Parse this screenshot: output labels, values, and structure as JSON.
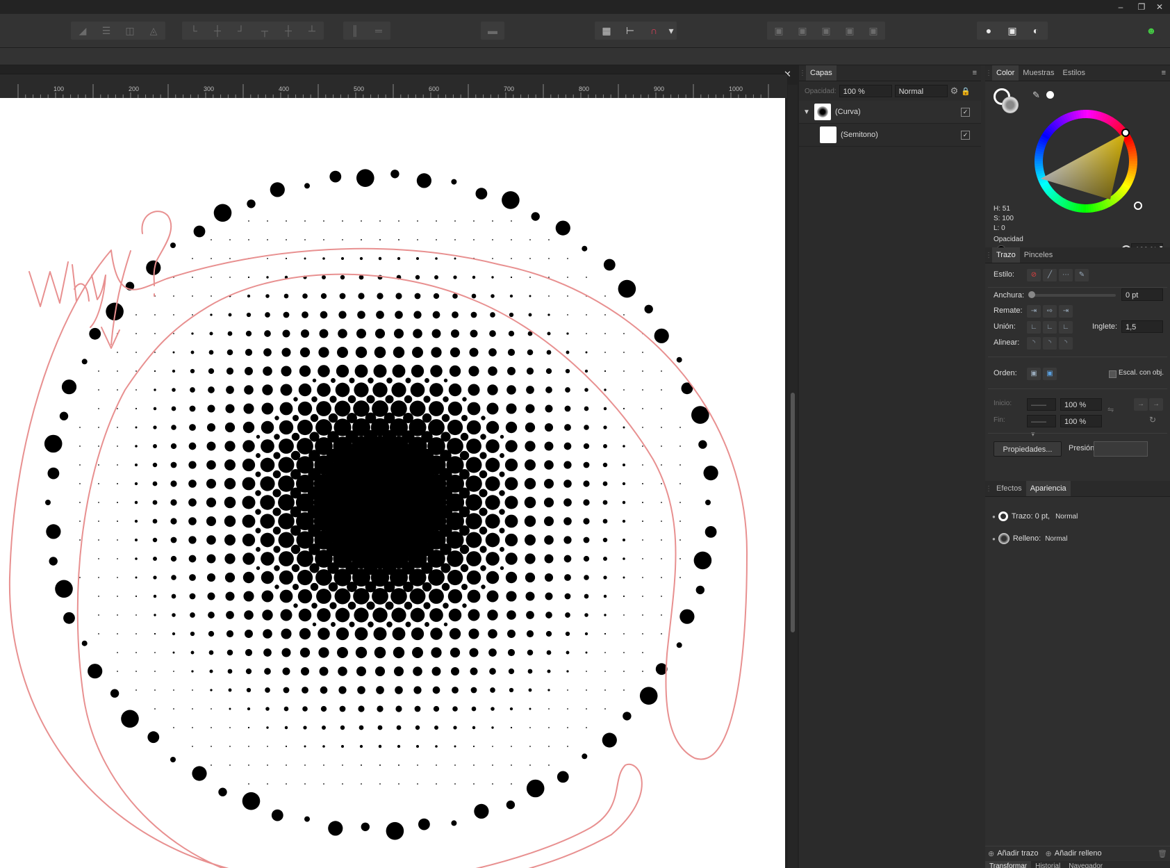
{
  "ruler": {
    "ticks": [
      "100",
      "200",
      "300",
      "400",
      "500",
      "600",
      "700",
      "800",
      "900",
      "1000"
    ]
  },
  "annotation": {
    "text": "Why?"
  },
  "layers_panel": {
    "tab": "Capas",
    "opacity_label": "Opacidad:",
    "opacity_value": "100 %",
    "blend_mode": "Normal",
    "layers": [
      {
        "name": "(Curva)",
        "visible": true
      },
      {
        "name": "(Semitono)",
        "visible": true
      }
    ]
  },
  "color_panel": {
    "tabs": [
      "Color",
      "Muestras",
      "Estilos"
    ],
    "h": "H: 51",
    "s": "S: 100",
    "l": "L: 0",
    "opacity_label": "Opacidad",
    "opacity_value": "100 %"
  },
  "stroke_panel": {
    "tabs": [
      "Trazo",
      "Pinceles"
    ],
    "style_label": "Estilo:",
    "width_label": "Anchura:",
    "width_value": "0 pt",
    "cap_label": "Remate:",
    "join_label": "Unión:",
    "miter_label": "Inglete:",
    "miter_value": "1,5",
    "align_label": "Alinear:",
    "order_label": "Orden:",
    "scale_label": "Escal. con obj.",
    "start_label": "Inicio:",
    "end_label": "Fin:",
    "start_pct": "100 %",
    "end_pct": "100 %",
    "properties_button": "Propiedades...",
    "pressure_label": "Presión:"
  },
  "appearance_panel": {
    "tabs": [
      "Efectos",
      "Apariencia"
    ],
    "stroke_item": "Trazo: 0 pt,",
    "stroke_mode": "Normal",
    "fill_item": "Relleno:",
    "fill_mode": "Normal",
    "add_stroke": "Añadir trazo",
    "add_fill": "Añadir relleno"
  },
  "bottom_tabs": [
    "Transformar",
    "Historial",
    "Navegador"
  ],
  "colors": {
    "accent": "#4aa3df",
    "annotation": "#e89090",
    "hue": "#ffd400"
  }
}
